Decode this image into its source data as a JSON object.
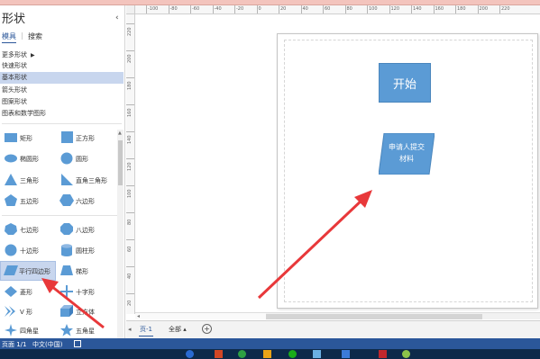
{
  "panel": {
    "title": "形状",
    "collapse_glyph": "‹",
    "tabs": {
      "model": "模具",
      "search": "搜索"
    },
    "stencils": [
      "更多形状",
      "快速形状",
      "基本形状",
      "箭头形状",
      "图案形状",
      "图表和数学图形"
    ],
    "active_stencil_index": 2,
    "shapes": [
      {
        "label": "矩形",
        "icon": "rectangle-icon"
      },
      {
        "label": "正方形",
        "icon": "square-icon"
      },
      {
        "label": "椭圆形",
        "icon": "ellipse-icon"
      },
      {
        "label": "圆形",
        "icon": "circle-icon"
      },
      {
        "label": "三角形",
        "icon": "triangle-icon"
      },
      {
        "label": "直角三角形",
        "icon": "right-triangle-icon"
      },
      {
        "label": "五边形",
        "icon": "pentagon-icon"
      },
      {
        "label": "六边形",
        "icon": "hexagon-icon"
      },
      {
        "label": "七边形",
        "icon": "heptagon-icon"
      },
      {
        "label": "八边形",
        "icon": "octagon-icon"
      },
      {
        "label": "十边形",
        "icon": "decagon-icon"
      },
      {
        "label": "圆柱形",
        "icon": "cylinder-icon"
      },
      {
        "label": "平行四边形",
        "icon": "parallelogram-icon"
      },
      {
        "label": "梯形",
        "icon": "trapezoid-icon"
      },
      {
        "label": "菱形",
        "icon": "diamond-icon"
      },
      {
        "label": "十字形",
        "icon": "cross-icon"
      },
      {
        "label": "V 形",
        "icon": "chevron-icon"
      },
      {
        "label": "立方体",
        "icon": "cube-icon"
      },
      {
        "label": "四角星",
        "icon": "four-point-star-icon"
      },
      {
        "label": "五角星",
        "icon": "five-point-star-icon"
      }
    ],
    "selected_shape_index": 12
  },
  "ruler": {
    "h_labels": [
      "-100",
      "-80",
      "-60",
      "-40",
      "-20",
      "0",
      "20",
      "40",
      "60",
      "80",
      "100",
      "120",
      "140",
      "160",
      "180",
      "200",
      "220"
    ],
    "v_labels": [
      "220",
      "200",
      "180",
      "160",
      "140",
      "120",
      "100",
      "80",
      "60",
      "40",
      "20"
    ]
  },
  "diagram": {
    "start_text": "开始",
    "apply_text_line1": "申请人提交",
    "apply_text_line2": "材料"
  },
  "pagebar": {
    "nav_glyph": "◂",
    "page_tab": "页-1",
    "all_pages": "全部 ▴",
    "add_glyph": "+"
  },
  "status": {
    "page": "页面 1/1",
    "language": "中文(中国)"
  },
  "colors": {
    "shape_fill": "#5b9bd5",
    "accent": "#2b579a",
    "annotation_arrow": "#e8383a",
    "active_stencil": "#c8d6ee"
  }
}
